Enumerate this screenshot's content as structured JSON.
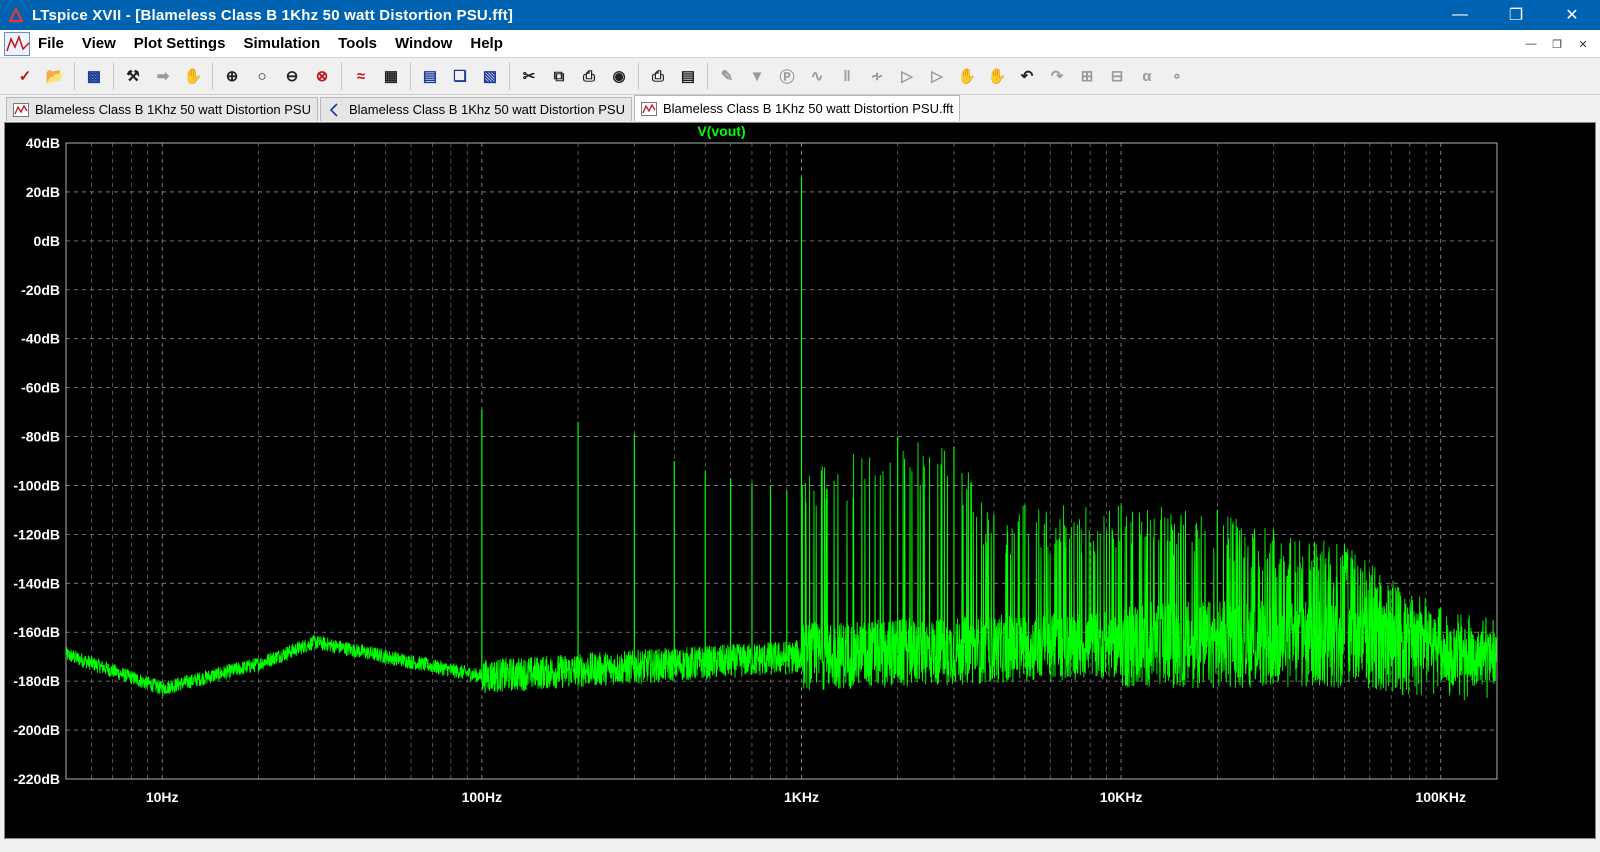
{
  "window": {
    "title": "LTspice XVII - [Blameless Class B 1Khz 50 watt Distortion PSU.fft]",
    "controls": [
      "minimize-icon",
      "restore-icon",
      "close-icon"
    ]
  },
  "menu": {
    "items": [
      "File",
      "View",
      "Plot Settings",
      "Simulation",
      "Tools",
      "Window",
      "Help"
    ]
  },
  "tabs": [
    {
      "label": "Blameless Class B 1Khz 50 watt Distortion PSU",
      "icon": "waveform-icon",
      "active": false
    },
    {
      "label": "Blameless Class B 1Khz 50 watt Distortion PSU",
      "icon": "schematic-icon",
      "active": false
    },
    {
      "label": "Blameless Class B 1Khz 50 watt Distortion PSU.fft",
      "icon": "waveform-icon",
      "active": true
    }
  ],
  "colors": {
    "trace": "#00ff00",
    "grid": "#8a8a8a",
    "axis_text": "#ffffff",
    "background": "#000000"
  },
  "chart_data": {
    "type": "line",
    "title": "V(vout)",
    "xscale": "log",
    "xlim": [
      5,
      150000
    ],
    "ylim": [
      -220,
      40
    ],
    "xlabel": "",
    "ylabel": "",
    "grid": true,
    "y_ticks": [
      "40dB",
      "20dB",
      "0dB",
      "-20dB",
      "-40dB",
      "-60dB",
      "-80dB",
      "-100dB",
      "-120dB",
      "-140dB",
      "-160dB",
      "-180dB",
      "-200dB",
      "-220dB"
    ],
    "y_tick_values": [
      40,
      20,
      0,
      -20,
      -40,
      -60,
      -80,
      -100,
      -120,
      -140,
      -160,
      -180,
      -200,
      -220
    ],
    "x_ticks": [
      "10Hz",
      "100Hz",
      "1KHz",
      "10KHz",
      "100KHz"
    ],
    "x_tick_values": [
      10,
      100,
      1000,
      10000,
      100000
    ],
    "series": [
      {
        "name": "V(vout)",
        "fundamental": {
          "x": 1000,
          "y": 26
        },
        "peaks": [
          {
            "x": 100,
            "y": -69
          },
          {
            "x": 200,
            "y": -74
          },
          {
            "x": 300,
            "y": -79
          },
          {
            "x": 400,
            "y": -90
          },
          {
            "x": 500,
            "y": -94
          },
          {
            "x": 600,
            "y": -97
          },
          {
            "x": 700,
            "y": -99
          },
          {
            "x": 800,
            "y": -100
          },
          {
            "x": 900,
            "y": -102
          },
          {
            "x": 2000,
            "y": -80
          },
          {
            "x": 3000,
            "y": -84
          },
          {
            "x": 4000,
            "y": -112
          },
          {
            "x": 5000,
            "y": -108
          },
          {
            "x": 10000,
            "y": -108
          },
          {
            "x": 20000,
            "y": -110
          },
          {
            "x": 30000,
            "y": -118
          },
          {
            "x": 50000,
            "y": -124
          },
          {
            "x": 100000,
            "y": -150
          }
        ],
        "noise_floor": [
          {
            "x": 5,
            "y": -169
          },
          {
            "x": 10,
            "y": -183
          },
          {
            "x": 20,
            "y": -173
          },
          {
            "x": 30,
            "y": -164
          },
          {
            "x": 100,
            "y": -178
          },
          {
            "x": 1000,
            "y": -170
          },
          {
            "x": 10000,
            "y": -165
          },
          {
            "x": 50000,
            "y": -165
          },
          {
            "x": 150000,
            "y": -172
          }
        ]
      }
    ]
  }
}
